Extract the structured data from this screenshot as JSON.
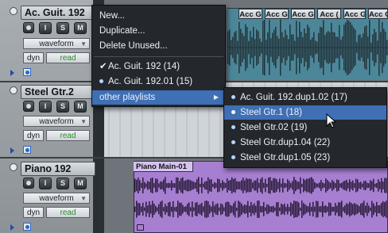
{
  "tracks": [
    {
      "name": "Ac. Guit. 192",
      "view_mode": "waveform",
      "dyn_label": "dyn",
      "automation_mode": "read",
      "buttons": [
        "I",
        "S",
        "M"
      ]
    },
    {
      "name": "Steel Gtr.2",
      "view_mode": "waveform",
      "dyn_label": "dyn",
      "automation_mode": "read",
      "buttons": [
        "I",
        "S",
        "M"
      ]
    },
    {
      "name": "Piano 192",
      "view_mode": "waveform",
      "dyn_label": "dyn",
      "automation_mode": "read",
      "buttons": [
        "I",
        "S",
        "M"
      ]
    }
  ],
  "clips": {
    "ac_guit_labels": [
      "Acc G",
      "Acc G",
      "Acc G",
      "Acc (",
      "Acc G",
      "Acc G"
    ],
    "piano_label": "Piano Main-01"
  },
  "playlist_menu": {
    "items": [
      "New...",
      "Duplicate...",
      "Delete Unused..."
    ],
    "playlists": [
      {
        "label": "Ac. Guit. 192 (14)",
        "checked": true
      },
      {
        "label": "Ac. Guit. 192.01 (15)",
        "checked": false
      }
    ],
    "submenu_label": "other playlists"
  },
  "submenu": {
    "items": [
      {
        "label": "Ac. Guit. 192.dup1.02 (17)",
        "highlighted": false
      },
      {
        "label": "Steel Gtr.1 (18)",
        "highlighted": true
      },
      {
        "label": "Steel Gtr.02 (19)",
        "highlighted": false
      },
      {
        "label": "Steel Gtr.dup1.04 (22)",
        "highlighted": false
      },
      {
        "label": "Steel Gtr.dup1.05 (23)",
        "highlighted": false
      }
    ]
  },
  "colors": {
    "ac_guit_clip": "#4c8799",
    "piano_clip": "#a77fd1",
    "menu_bg": "#24282d",
    "menu_highlight": "#3f6fb5"
  }
}
